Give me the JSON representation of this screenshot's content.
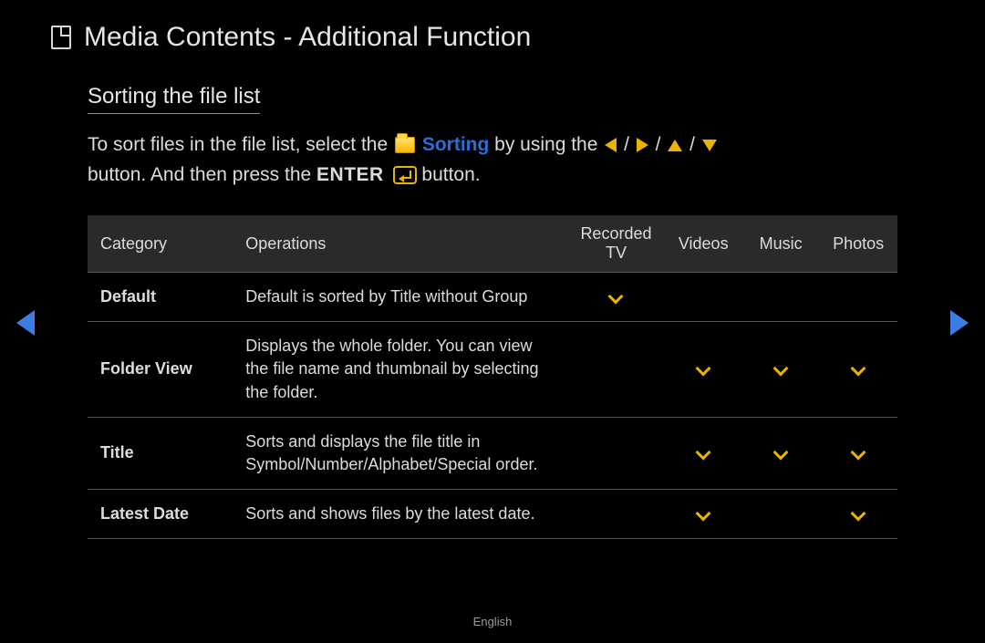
{
  "page_title": "Media Contents - Additional Function",
  "subtitle": "Sorting the file list",
  "intro": {
    "part1": "To sort files in the file list, select the ",
    "sorting_label": "Sorting",
    "part2": " by using the ",
    "sep": " / ",
    "part3": " button. And then press the ",
    "enter_label": "ENTER",
    "part4": " button."
  },
  "table": {
    "headers": [
      "Category",
      "Operations",
      "Recorded TV",
      "Videos",
      "Music",
      "Photos"
    ],
    "rows": [
      {
        "category": "Default",
        "operation": "Default is sorted by Title without Group",
        "marks": [
          true,
          false,
          false,
          false
        ]
      },
      {
        "category": "Folder View",
        "operation": "Displays the whole folder. You can view the file name and thumbnail by selecting the folder.",
        "marks": [
          false,
          true,
          true,
          true
        ]
      },
      {
        "category": "Title",
        "operation": "Sorts and displays the file title in Symbol/Number/Alphabet/Special order.",
        "marks": [
          false,
          true,
          true,
          true
        ]
      },
      {
        "category": "Latest Date",
        "operation": "Sorts and shows files by the latest date.",
        "marks": [
          false,
          true,
          false,
          true
        ]
      }
    ]
  },
  "footer_language": "English"
}
